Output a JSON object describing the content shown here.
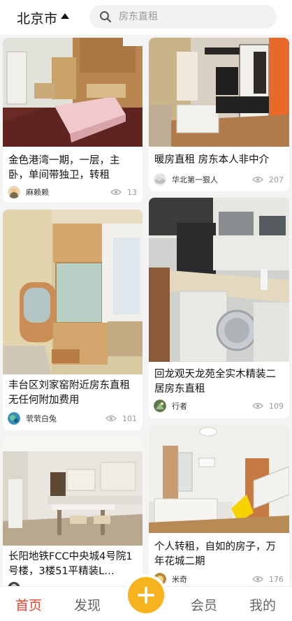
{
  "header": {
    "city": "北京市",
    "search_placeholder": "房东直租"
  },
  "listings": [
    {
      "title": "金色港湾一期，一层，主卧，单间带独卫，转租",
      "author": "麻赖赖",
      "views": "13"
    },
    {
      "title": "暖房直租 房东本人非中介",
      "author": "华北第一狠人",
      "views": "207"
    },
    {
      "title": "丰台区刘家窑附近房东直租无任何附加费用",
      "author": "茕茕白兔",
      "views": "101"
    },
    {
      "title": "回龙观天龙苑全实木精装二居房东直租",
      "author": "行者",
      "views": "109"
    },
    {
      "title": "长阳地铁FCC中央城4号院1号楼，3楼51平精装L…",
      "author": "",
      "views": ""
    },
    {
      "title": "个人转租，自如的房子，万年花城二期",
      "author": "米奇",
      "views": "176"
    }
  ],
  "nav": {
    "home": "首页",
    "discover": "发现",
    "member": "会员",
    "mine": "我的"
  },
  "colors": {
    "accent": "#e8442f",
    "fab": "#f7b31d"
  },
  "icons": [
    "caret-up-icon",
    "search-icon",
    "eye-icon",
    "plus-icon"
  ]
}
